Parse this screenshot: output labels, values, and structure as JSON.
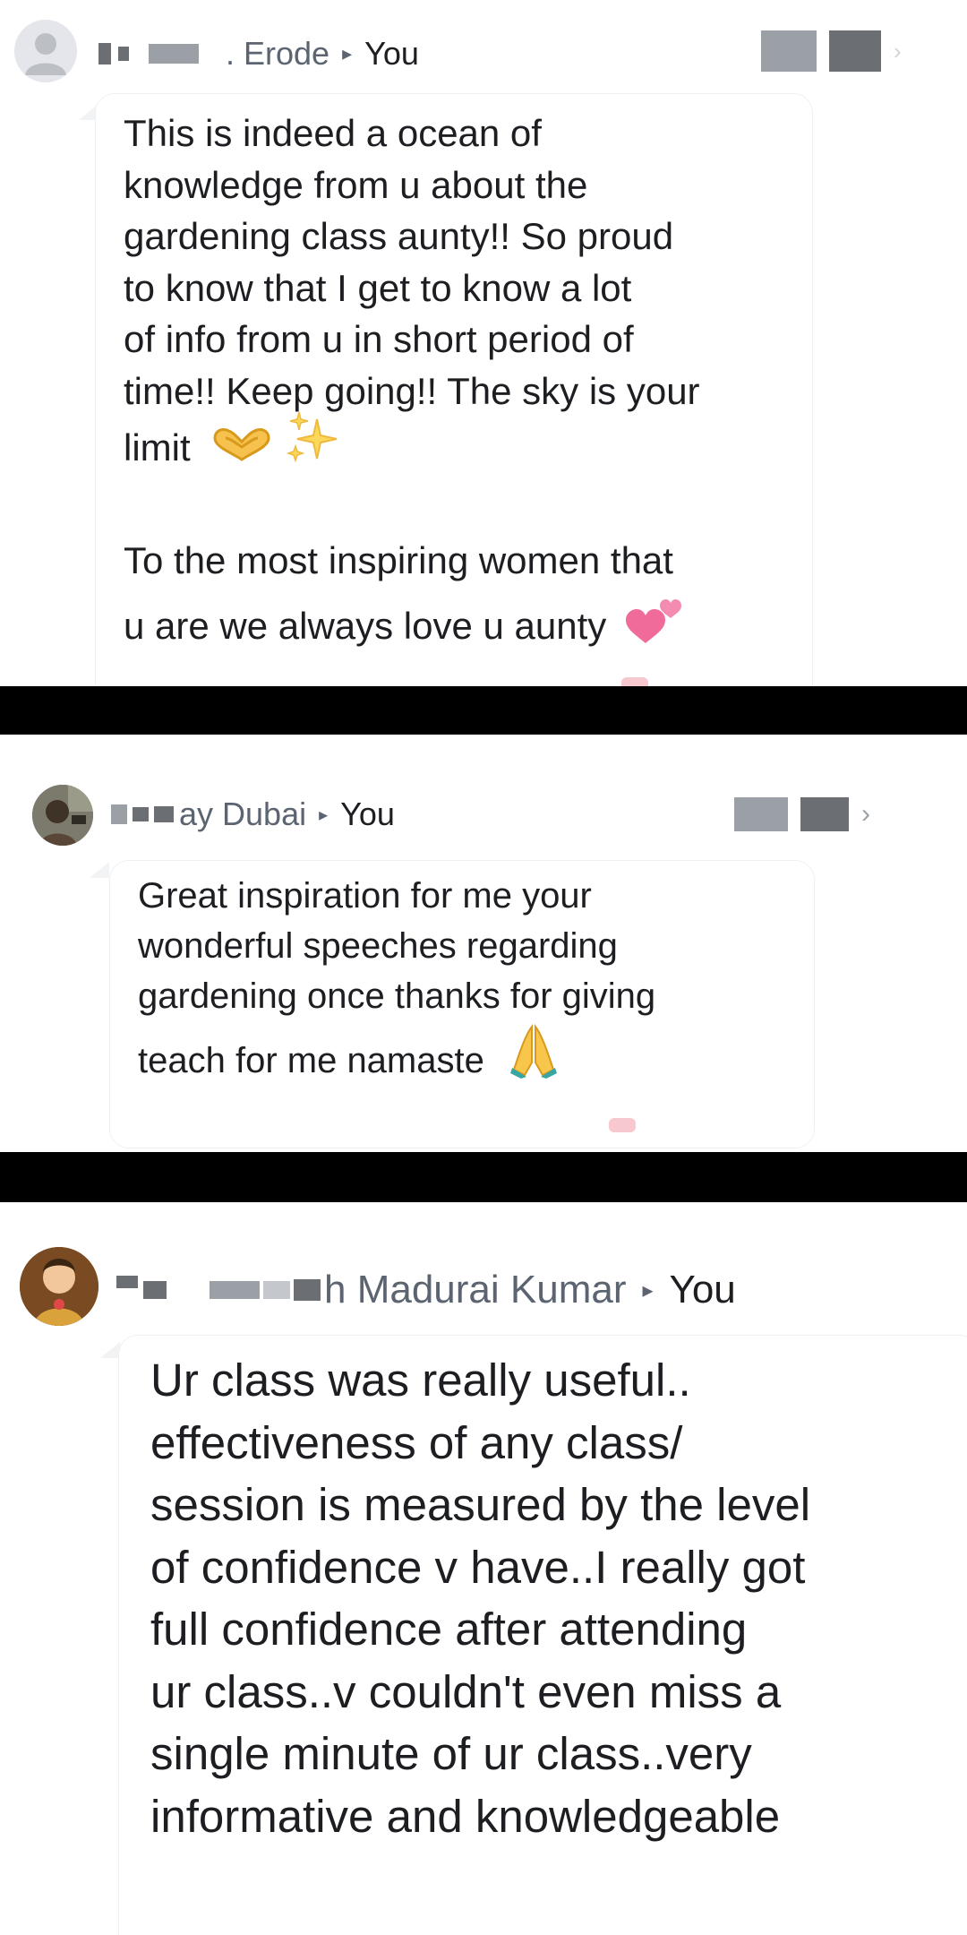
{
  "colors": {
    "divider": "#000000",
    "name": "#5b6470",
    "text": "#1c1e21",
    "heart": "#f06a9a"
  },
  "messages": [
    {
      "sender": ". Erode",
      "arrow": "▸",
      "recipient": "You",
      "text_line_1": "This is indeed a ocean of\nknowledge from u about the\ngardening class aunty!! So proud\nto know that I  get to know a lot\nof info from u in short period of\ntime!! Keep going!! The sky is your",
      "text_limit": "limit",
      "text_line_2": "To the most inspiring women that",
      "text_line_3": "u are we always love u aunty",
      "emoji_icons": [
        "heart-hands-icon",
        "sparkles-icon",
        "two-hearts-icon"
      ]
    },
    {
      "sender": "ay Dubai",
      "arrow": "▸",
      "recipient": "You",
      "text_main": "Great inspiration  for me your\nwonderful  speeches regarding\ngardening  once thanks for giving",
      "text_last": "teach for me namaste",
      "emoji_icons": [
        "folded-hands-icon"
      ]
    },
    {
      "sender": "h Madurai Kumar",
      "arrow": "▸",
      "recipient": "You",
      "text": "Ur class was really useful..\neffectiveness of any class/\nsession is measured by the level\nof confidence v have..I really got\nfull confidence after attending\nur class..v couldn't even miss a\nsingle minute of ur class..very\ninformative and knowledgeable"
    }
  ],
  "icons": {
    "chevron": "›"
  }
}
